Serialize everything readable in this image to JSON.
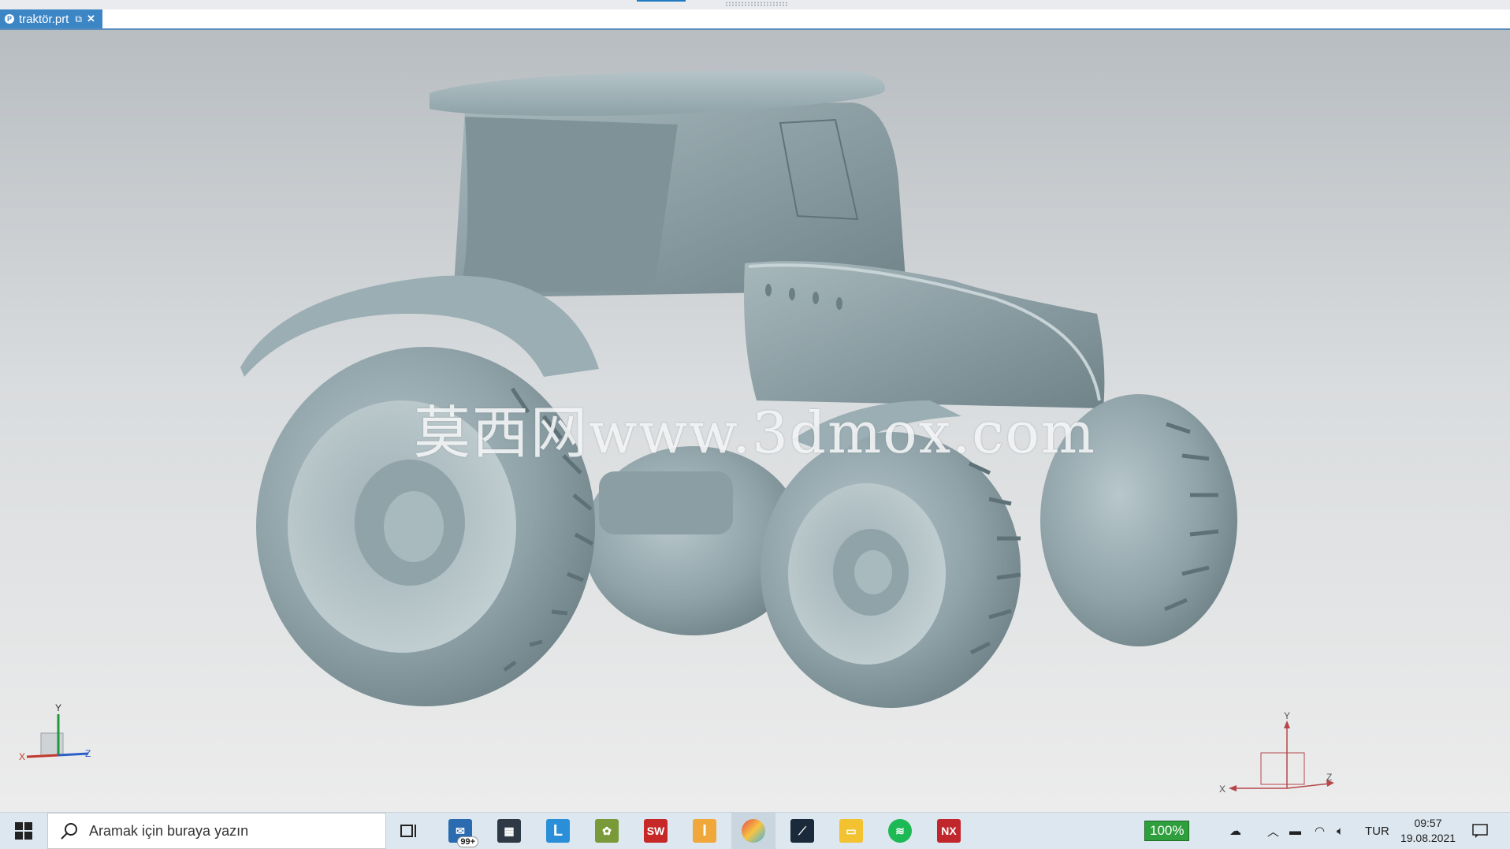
{
  "document_tab": {
    "label": "traktör.prt",
    "undock_icon": "undock-icon",
    "close_symbol": "✕"
  },
  "viewport": {
    "watermark": "莫西网www.3dmox.com",
    "triad_left": {
      "x": "X",
      "y": "Y",
      "z": "Z"
    },
    "triad_right": {
      "x": "X",
      "y": "Y",
      "z": "Z"
    },
    "colors": {
      "model": "#8ea2a8",
      "bg_top": "#b8bdc1",
      "bg_bottom": "#ececec"
    }
  },
  "taskbar": {
    "start_icon": "windows-logo-icon",
    "search_placeholder": "Aramak için buraya yazın",
    "mail_badge": "99+",
    "apps": [
      "task-view",
      "mail",
      "store",
      "L-app",
      "paint-app",
      "solidworks",
      "I-app",
      "browser",
      "catia",
      "file-explorer",
      "spotify",
      "nx"
    ],
    "nx_label": "NX",
    "l_label": "L",
    "i_label": "I",
    "sw_label": "SW",
    "tray": {
      "battery_percent": "100%",
      "language": "TUR",
      "time": "09:57",
      "date": "19.08.2021"
    }
  }
}
